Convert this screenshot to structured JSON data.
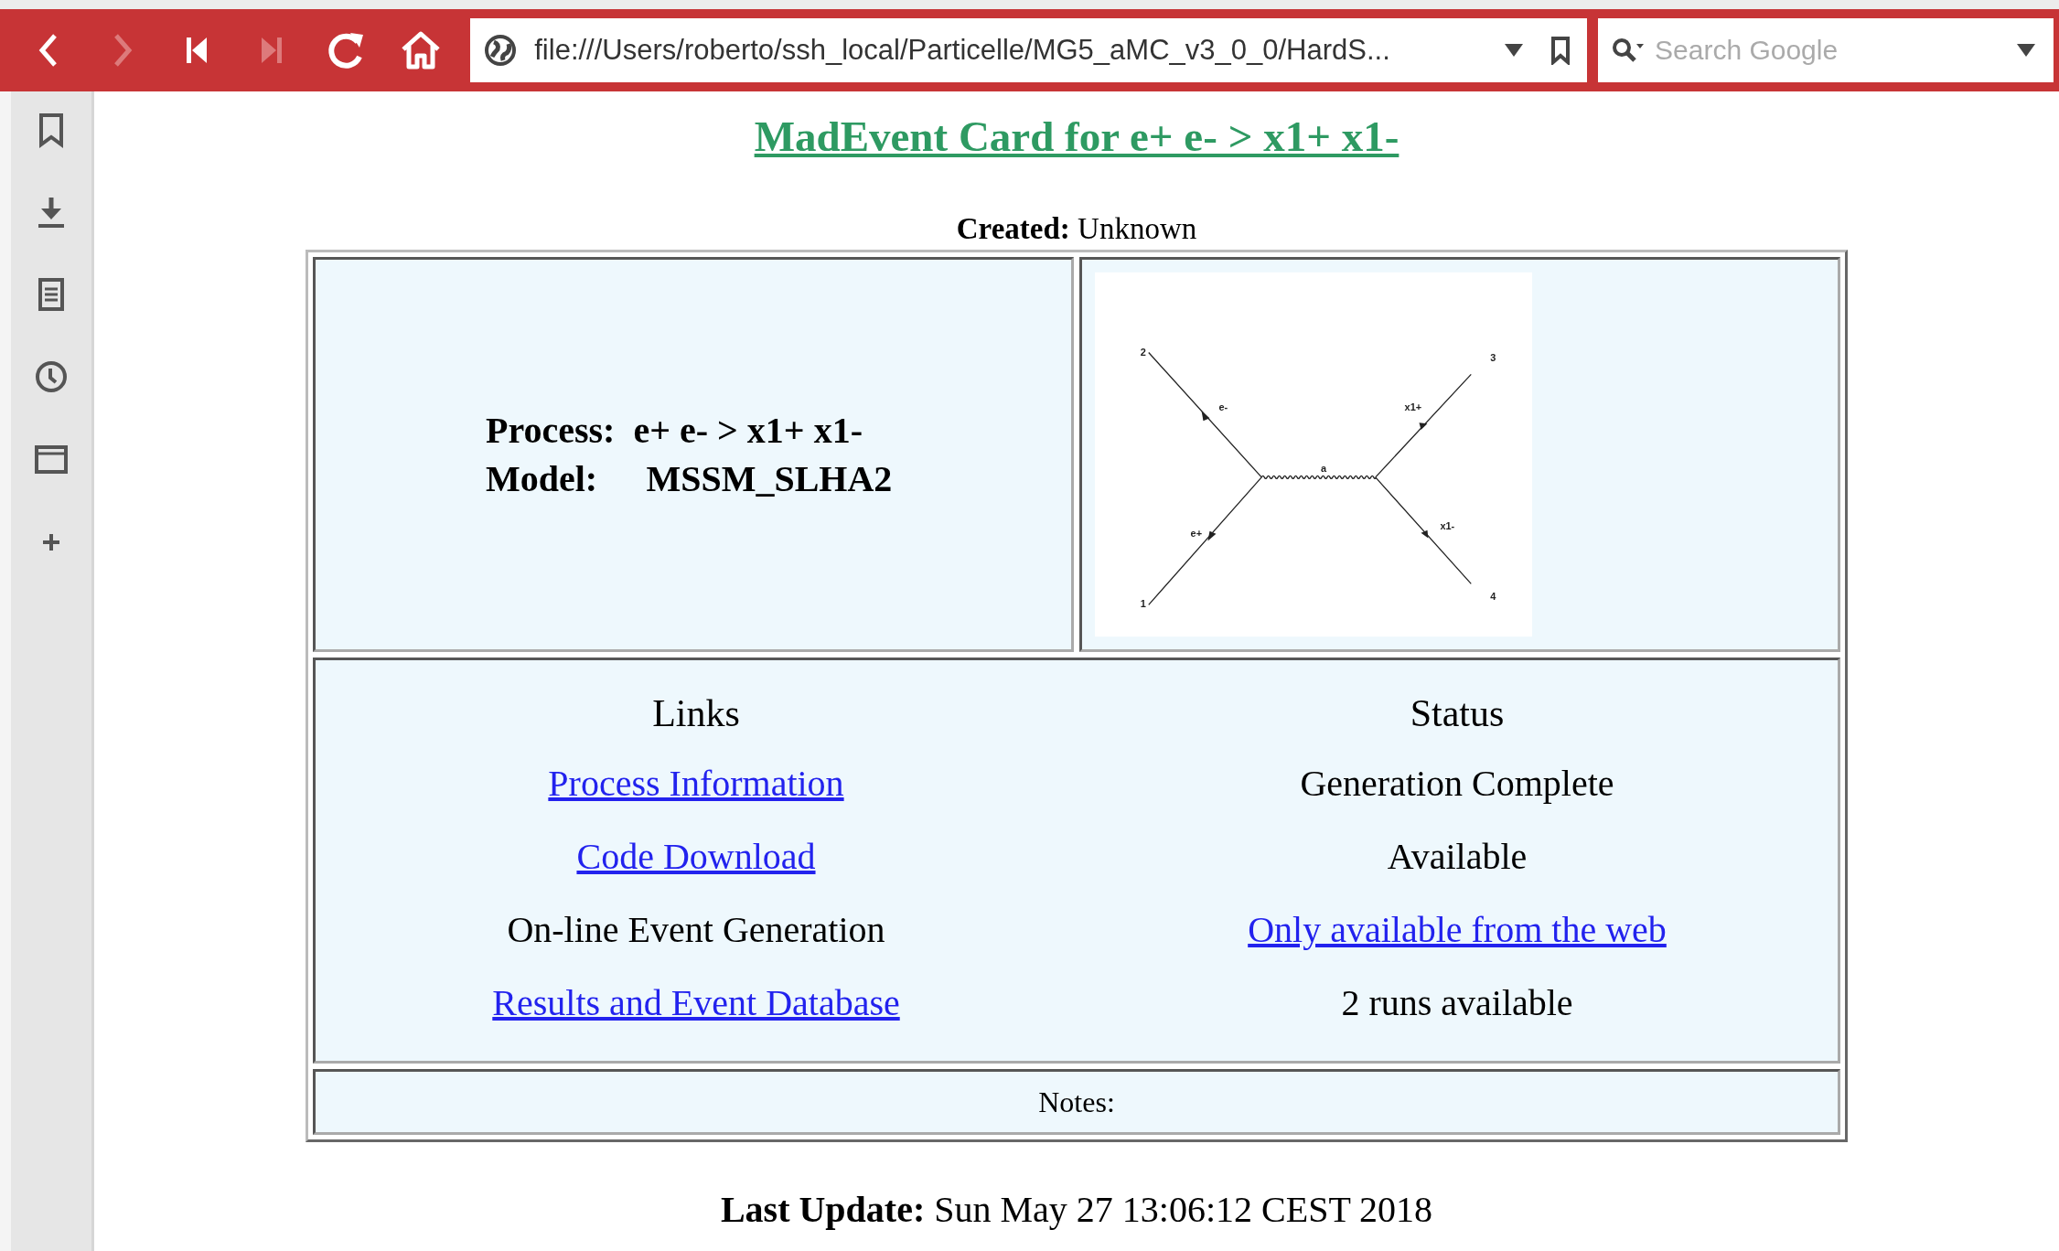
{
  "toolbar": {
    "buttons": [
      {
        "kind": "back",
        "disabled": false
      },
      {
        "kind": "forward",
        "disabled": true
      },
      {
        "kind": "rewind",
        "disabled": false
      },
      {
        "kind": "fast-forward",
        "disabled": true
      },
      {
        "kind": "reload",
        "disabled": false
      },
      {
        "kind": "home",
        "disabled": false
      }
    ],
    "url": "file:///Users/roberto/ssh_local/Particelle/MG5_aMC_v3_0_0/HardS...",
    "search": {
      "placeholder": "Search Google"
    }
  },
  "sidebar": {
    "items": [
      {
        "kind": "bookmark"
      },
      {
        "kind": "download"
      },
      {
        "kind": "notes"
      },
      {
        "kind": "history"
      },
      {
        "kind": "window"
      },
      {
        "kind": "add"
      }
    ]
  },
  "page": {
    "title": "MadEvent Card for e+ e- > x1+ x1-",
    "created": {
      "label": "Created:",
      "value": "Unknown"
    },
    "process": {
      "label": "Process:",
      "value": "e+ e- > x1+ x1-"
    },
    "model": {
      "label": "Model:",
      "value": "MSSM_SLHA2"
    },
    "diagram": {
      "labels": [
        "2",
        "e-",
        "e+",
        "1",
        "a",
        "x1+",
        "3",
        "x1-",
        "4"
      ]
    },
    "links": {
      "heading": "Links",
      "items": [
        {
          "kind": "link",
          "text": "Process Information"
        },
        {
          "kind": "link",
          "text": "Code Download"
        },
        {
          "kind": "text",
          "text": "On-line Event Generation"
        },
        {
          "kind": "link",
          "text": "Results and Event Database"
        }
      ]
    },
    "status": {
      "heading": "Status",
      "items": [
        {
          "kind": "text",
          "text": "Generation Complete"
        },
        {
          "kind": "text",
          "text": "Available"
        },
        {
          "kind": "link",
          "text": "Only available from the web"
        },
        {
          "kind": "text",
          "text": "2 runs available"
        }
      ]
    },
    "notes": "Notes:",
    "last_update": {
      "label": "Last Update:",
      "value": "Sun May 27 13:06:12 CEST 2018"
    }
  }
}
